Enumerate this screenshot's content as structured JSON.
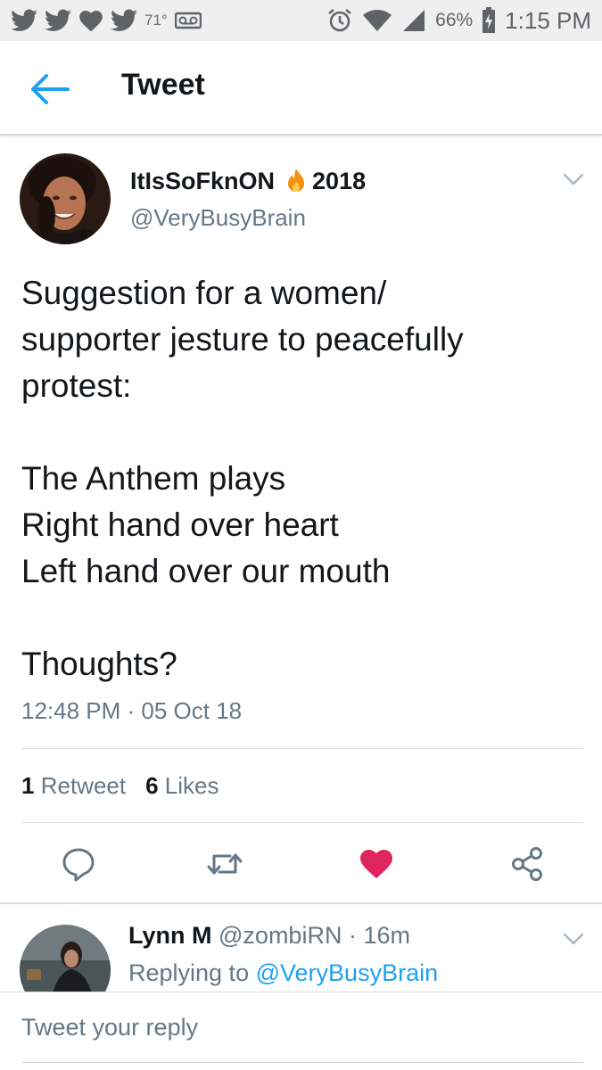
{
  "status_bar": {
    "temperature": "71°",
    "battery": "66%",
    "time": "1:15 PM",
    "notification_icons": [
      "twitter-icon",
      "twitter-icon",
      "heart-icon",
      "twitter-icon",
      "voicemail-icon"
    ],
    "system_icons": [
      "alarm-icon",
      "wifi-icon",
      "signal-icon",
      "battery-charging-icon"
    ]
  },
  "header": {
    "title": "Tweet",
    "back_icon": "back-arrow-icon"
  },
  "tweet": {
    "author": {
      "name": "ItIsSoFknON",
      "name_suffix": "2018",
      "handle": "@VeryBusyBrain"
    },
    "text_lines": [
      "Suggestion for a women/",
      "supporter jesture to peacefully",
      "protest:",
      "",
      "The Anthem plays",
      "Right hand over heart",
      "Left hand over our mouth",
      "",
      "Thoughts?"
    ],
    "timestamp": "12:48 PM · 05 Oct 18",
    "retweets": {
      "count": "1",
      "label": "Retweet"
    },
    "likes": {
      "count": "6",
      "label": "Likes"
    },
    "actions": [
      "reply-icon",
      "retweet-icon",
      "like-icon",
      "share-icon"
    ],
    "liked": true
  },
  "reply": {
    "name": "Lynn M",
    "handle": "@zombiRN",
    "time": "· 16m",
    "replying_prefix": "Replying to",
    "replying_to": "@VeryBusyBrain"
  },
  "composer": {
    "placeholder": "Tweet your reply"
  },
  "colors": {
    "accent": "#1da1f2",
    "like": "#e0245e",
    "secondary_text": "#657786",
    "primary_text": "#14171a",
    "status_bar_bg": "#efefef"
  }
}
